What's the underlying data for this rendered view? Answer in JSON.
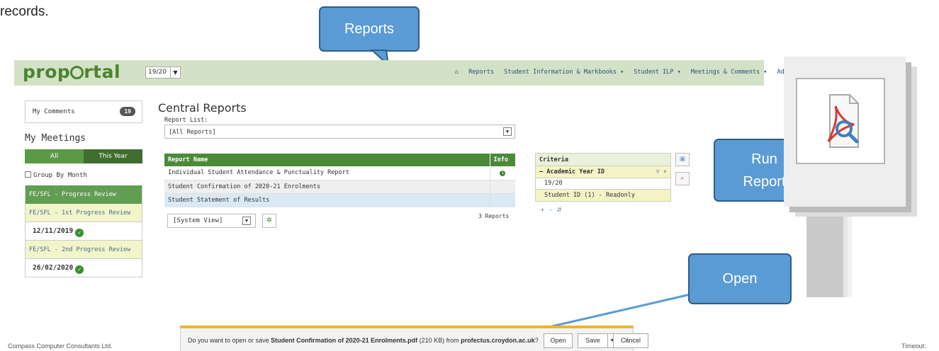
{
  "doc_text": "records.",
  "header": {
    "logo": "proportal",
    "year_value": "19/20",
    "nav": [
      "Reports",
      "Student Information & Markbooks ▾",
      "Student ILP ▾",
      "Meetings & Comments ▾",
      "Additiona"
    ]
  },
  "sidebar": {
    "my_comments_label": "My Comments",
    "my_comments_count": "19",
    "meetings_title": "My Meetings",
    "tab_all": "All",
    "tab_this_year": "This Year",
    "group_by_month": "Group By Month",
    "progress_review_header": "FE/SFL - Progress Review",
    "reviews": [
      {
        "label": "FE/SFL - 1st Progress Review",
        "date": "12/11/2019"
      },
      {
        "label": "FE/SFL - 2nd Progress Review",
        "date": "26/02/2020"
      }
    ]
  },
  "main": {
    "title": "Central Reports",
    "report_list_label": "Report List:",
    "report_list_value": "[All Reports]",
    "table": {
      "col_name": "Report Name",
      "col_info": "Info",
      "rows": [
        "Individual Student Attendance & Punctuality Report",
        "Student Confirmation of 2020-21 Enrolments",
        "Student Statement of Results"
      ]
    },
    "view_value": "[System View]",
    "report_count": "3 Reports"
  },
  "criteria": {
    "header": "Criteria",
    "group_label": "– Academic Year ID",
    "group_value": "19/20",
    "student_label": "Student ID (1) - Readonly",
    "controls": "+ – ⇵"
  },
  "callouts": {
    "reports": "Reports",
    "run_line1": "Run",
    "run_line2": "Report",
    "open": "Open"
  },
  "download_bar": {
    "message_prefix": "Do you want to open or save ",
    "file_name": "Student Confirmation of 2020-21 Enrolments.pdf",
    "size": " (210 KB) from ",
    "source": "profectus.croydon.ac.uk",
    "message_suffix": "?",
    "open_label": "Open",
    "save_label": "Save",
    "cancel_label": "Cancel"
  },
  "status": {
    "left": "Compass Computer Consultants Ltd.",
    "right": "Timeout:"
  },
  "colors": {
    "brand_green": "#4a8430",
    "topbar": "#d3e2c6",
    "callout_blue": "#5b9bd5",
    "notification_yellow": "#f0b429"
  },
  "icons": [
    "home-icon",
    "check-circle-icon",
    "info-icon",
    "gear-icon",
    "preview-icon",
    "pdf-report-icon",
    "filter-icon",
    "close-icon",
    "chevron-down-icon"
  ]
}
